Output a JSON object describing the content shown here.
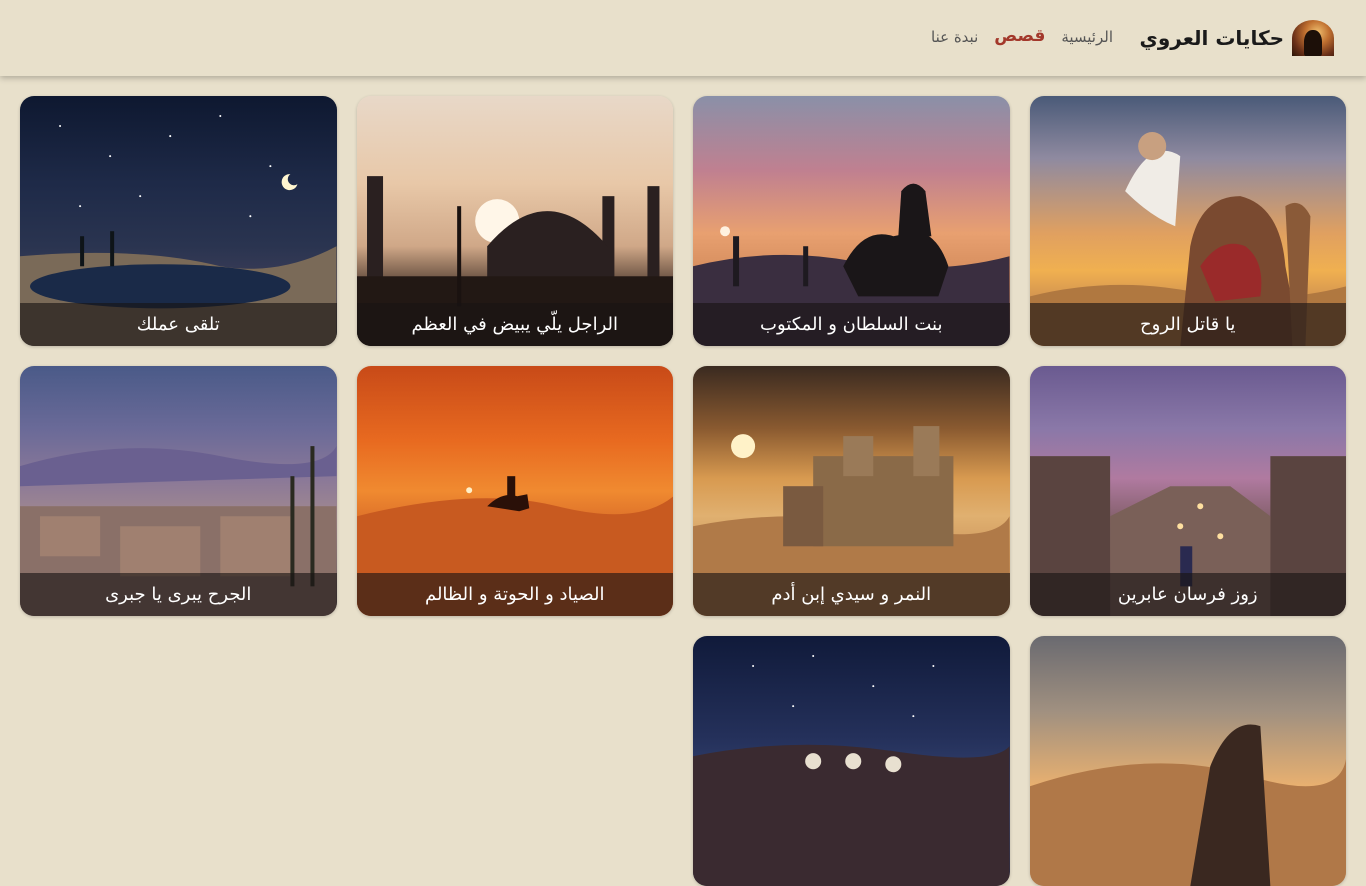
{
  "header": {
    "brand_title": "حكايات العروي",
    "nav": [
      {
        "label": "الرئيسية",
        "active": false
      },
      {
        "label": "قصص",
        "active": true
      },
      {
        "label": "نبدة عنا",
        "active": false
      }
    ]
  },
  "stories": [
    {
      "title": "يا قاتل الروح"
    },
    {
      "title": "بنت السلطان و المكتوب"
    },
    {
      "title": "الراجل يلّي يبيض في العظم"
    },
    {
      "title": "تلقى عملك"
    },
    {
      "title": "زوز فرسان عابرين"
    },
    {
      "title": "النمر و سيدي إبن أدم"
    },
    {
      "title": "الصياد و الحوتة و الظالم"
    },
    {
      "title": "الجرح يبرى يا جبرى"
    },
    {
      "title": ""
    },
    {
      "title": ""
    }
  ],
  "colors": {
    "background": "#e8e0cb",
    "active_nav": "#a3382b"
  }
}
